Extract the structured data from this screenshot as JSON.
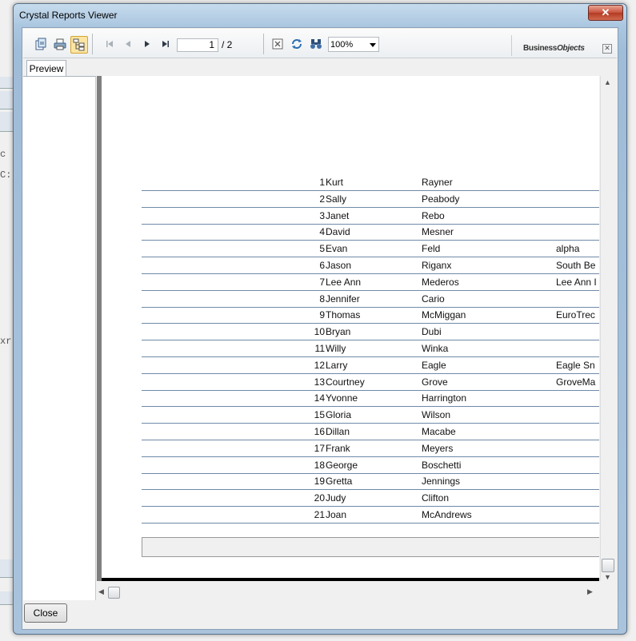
{
  "background": {
    "fragments": [
      "c",
      "C:",
      "xr"
    ]
  },
  "window": {
    "title": "Crystal Reports Viewer",
    "close_glyph": "✕"
  },
  "toolbar": {
    "page_current": "1",
    "page_total": "/ 2",
    "zoom": "100%",
    "brand_a": "Business",
    "brand_b": "Objects",
    "icons": [
      "export-icon",
      "print-icon",
      "group-tree-toggle-icon",
      "first-page-icon",
      "previous-page-icon",
      "next-page-icon",
      "last-page-icon",
      "stop-icon",
      "refresh-icon",
      "search-icon"
    ]
  },
  "tabs": {
    "preview": "Preview"
  },
  "report": {
    "rows": [
      {
        "id": "1",
        "first": "Kurt",
        "last": "Rayner",
        "company": ""
      },
      {
        "id": "2",
        "first": "Sally",
        "last": "Peabody",
        "company": ""
      },
      {
        "id": "3",
        "first": "Janet",
        "last": "Rebo",
        "company": ""
      },
      {
        "id": "4",
        "first": "David",
        "last": "Mesner",
        "company": ""
      },
      {
        "id": "5",
        "first": "Evan",
        "last": "Feld",
        "company": "alpha"
      },
      {
        "id": "6",
        "first": "Jason",
        "last": "Riganx",
        "company": "South Be"
      },
      {
        "id": "7",
        "first": "Lee Ann",
        "last": "Mederos",
        "company": "Lee Ann I"
      },
      {
        "id": "8",
        "first": "Jennifer",
        "last": "Cario",
        "company": ""
      },
      {
        "id": "9",
        "first": "Thomas",
        "last": "McMiggan",
        "company": "EuroTrec"
      },
      {
        "id": "10",
        "first": "Bryan",
        "last": "Dubi",
        "company": ""
      },
      {
        "id": "11",
        "first": "Willy",
        "last": "Winka",
        "company": ""
      },
      {
        "id": "12",
        "first": "Larry",
        "last": "Eagle",
        "company": "Eagle Sn"
      },
      {
        "id": "13",
        "first": "Courtney",
        "last": "Grove",
        "company": "GroveMa"
      },
      {
        "id": "14",
        "first": "Yvonne",
        "last": "Harrington",
        "company": ""
      },
      {
        "id": "15",
        "first": "Gloria",
        "last": "Wilson",
        "company": ""
      },
      {
        "id": "16",
        "first": "Dillan",
        "last": "Macabe",
        "company": ""
      },
      {
        "id": "17",
        "first": "Frank",
        "last": "Meyers",
        "company": ""
      },
      {
        "id": "18",
        "first": "George",
        "last": "Boschetti",
        "company": ""
      },
      {
        "id": "19",
        "first": "Gretta",
        "last": "Jennings",
        "company": ""
      },
      {
        "id": "20",
        "first": "Judy",
        "last": "Clifton",
        "company": ""
      },
      {
        "id": "21",
        "first": "Joan",
        "last": "McAndrews",
        "company": ""
      }
    ]
  },
  "footer": {
    "close_label": "Close"
  }
}
